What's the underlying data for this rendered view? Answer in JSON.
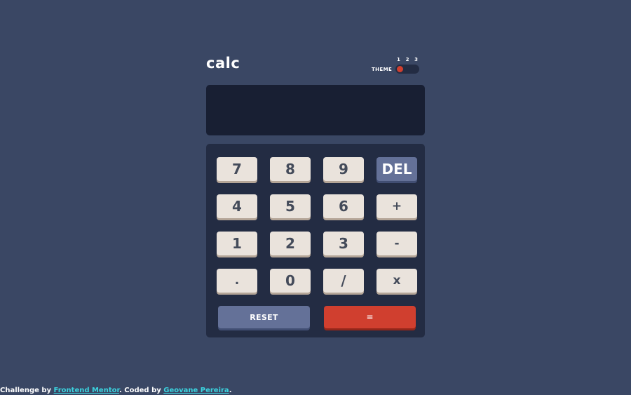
{
  "header": {
    "logo": "calc",
    "theme_label": "THEME",
    "theme_options": [
      "1",
      "2",
      "3"
    ],
    "active_theme": 1
  },
  "display": {
    "value": ""
  },
  "keypad": {
    "keys": [
      "7",
      "8",
      "9",
      "DEL",
      "4",
      "5",
      "6",
      "+",
      "1",
      "2",
      "3",
      "-",
      ".",
      "0",
      "/",
      "x"
    ],
    "reset_label": "RESET",
    "equals_label": "="
  },
  "footer": {
    "prefix": "Challenge by",
    "challenge_link": "Frontend Mentor",
    "middle": ". Coded by",
    "author_link": "Geovane Pereira",
    "suffix": "."
  },
  "colors": {
    "main_background": "#3a4764",
    "keypad_background": "#232c43",
    "screen_background": "#181f33",
    "key_background": "#eae3dc",
    "key_text": "#444b5a",
    "del_reset_background": "#647198",
    "equals_background": "#d03f2f",
    "link": "#3bd4e0"
  }
}
